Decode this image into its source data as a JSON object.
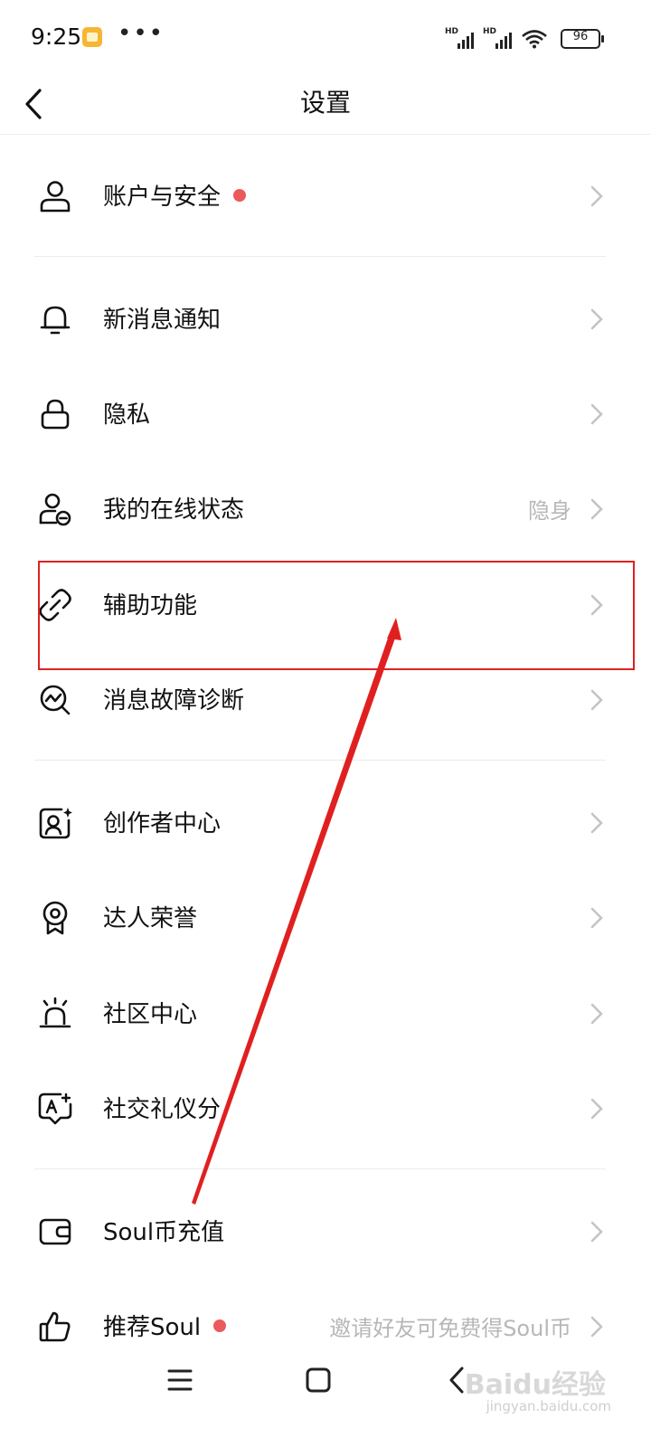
{
  "status_bar": {
    "time": "9:25",
    "dots": "•••",
    "signal_label": "HD",
    "battery": "96"
  },
  "header": {
    "title": "设置"
  },
  "menu": [
    {
      "label": "账户与安全",
      "icon": "user-icon",
      "badge": true,
      "value": ""
    },
    {
      "label": "新消息通知",
      "icon": "bell-icon",
      "badge": false,
      "value": ""
    },
    {
      "label": "隐私",
      "icon": "lock-icon",
      "badge": false,
      "value": ""
    },
    {
      "label": "我的在线状态",
      "icon": "online-status-icon",
      "badge": false,
      "value": "隐身"
    },
    {
      "label": "辅助功能",
      "icon": "link-icon",
      "badge": false,
      "value": ""
    },
    {
      "label": "消息故障诊断",
      "icon": "diagnosis-icon",
      "badge": false,
      "value": ""
    },
    {
      "label": "创作者中心",
      "icon": "creator-icon",
      "badge": false,
      "value": ""
    },
    {
      "label": "达人荣誉",
      "icon": "medal-icon",
      "badge": false,
      "value": ""
    },
    {
      "label": "社区中心",
      "icon": "alarm-icon",
      "badge": false,
      "value": ""
    },
    {
      "label": "社交礼仪分",
      "icon": "etiquette-icon",
      "badge": false,
      "value": ""
    },
    {
      "label": "Soul币充值",
      "icon": "wallet-icon",
      "badge": false,
      "value": ""
    },
    {
      "label": "推荐Soul",
      "icon": "thumbs-up-icon",
      "badge": true,
      "value": "邀请好友可免费得Soul币"
    }
  ],
  "watermark": {
    "text": "Baidu经验",
    "sub": "jingyan.baidu.com"
  },
  "colors": {
    "accent_red": "#e02020",
    "badge": "#ea5a5a",
    "muted_text": "#b7b7b7"
  }
}
